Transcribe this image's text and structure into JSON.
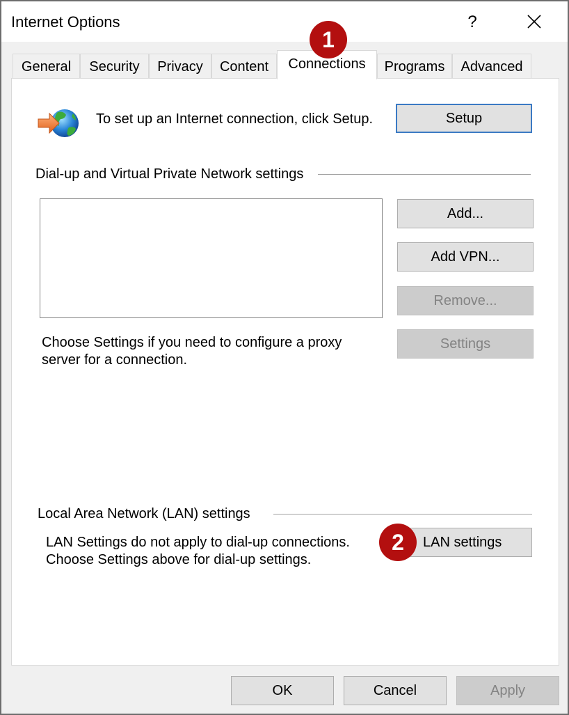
{
  "window": {
    "title": "Internet Options",
    "help_label": "?",
    "close_icon": "close-icon"
  },
  "tabs": [
    {
      "label": "General",
      "active": false
    },
    {
      "label": "Security",
      "active": false
    },
    {
      "label": "Privacy",
      "active": false
    },
    {
      "label": "Content",
      "active": false
    },
    {
      "label": "Connections",
      "active": true
    },
    {
      "label": "Programs",
      "active": false
    },
    {
      "label": "Advanced",
      "active": false
    }
  ],
  "setup": {
    "icon": "globe-arrow-icon",
    "text": "To set up an Internet connection, click Setup.",
    "button_label": "Setup"
  },
  "dialup": {
    "group_label": "Dial-up and Virtual Private Network settings",
    "list_items": [],
    "buttons": {
      "add": "Add...",
      "add_vpn": "Add VPN...",
      "remove": "Remove...",
      "settings": "Settings"
    },
    "proxy_text": "Choose Settings if you need to configure a proxy server for a connection."
  },
  "lan": {
    "group_label": "Local Area Network (LAN) settings",
    "text_line1": "LAN Settings do not apply to dial-up connections.",
    "text_line2": "Choose Settings above for dial-up settings.",
    "button_label": "LAN settings"
  },
  "footer": {
    "ok": "OK",
    "cancel": "Cancel",
    "apply": "Apply"
  },
  "annotations": {
    "step1": "1",
    "step2": "2",
    "badge_color": "#b30f0f"
  },
  "colors": {
    "focus_border": "#3b7ac4",
    "button_bg": "#e1e1e1",
    "disabled_bg": "#cccccc",
    "disabled_text": "#838383"
  }
}
